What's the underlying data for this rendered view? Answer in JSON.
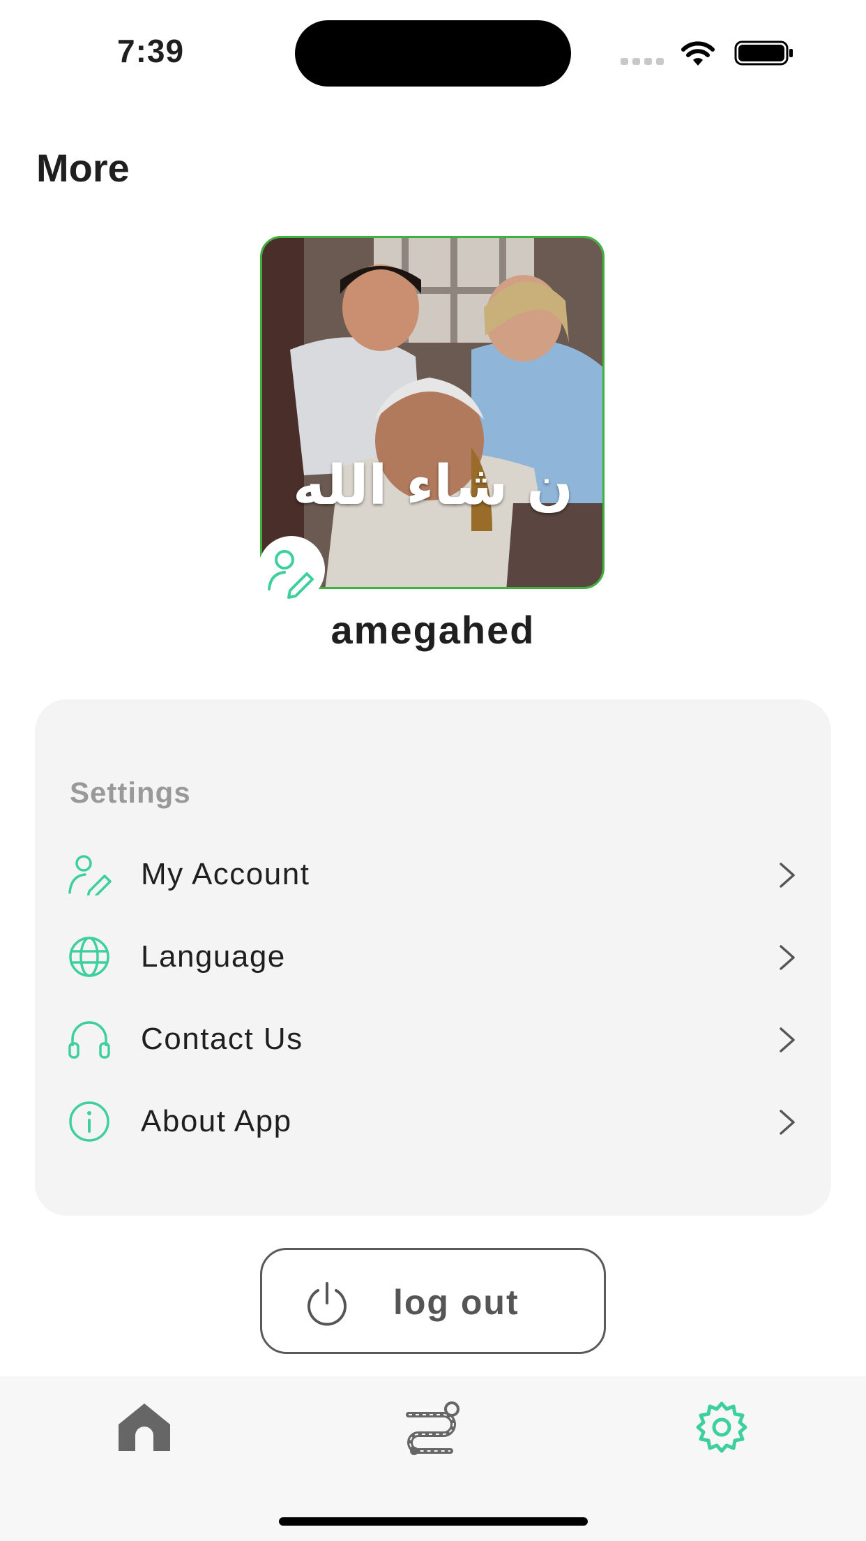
{
  "status_bar": {
    "time": "7:39"
  },
  "header": {
    "title": "More"
  },
  "profile": {
    "username": "amegahed",
    "avatar_caption": "ن شاء الله"
  },
  "settings": {
    "section_label": "Settings",
    "items": [
      {
        "label": "My Account",
        "icon": "user-edit-icon"
      },
      {
        "label": "Language",
        "icon": "globe-icon"
      },
      {
        "label": "Contact Us",
        "icon": "headset-icon"
      },
      {
        "label": "About App",
        "icon": "info-icon"
      }
    ]
  },
  "logout": {
    "label": "log out"
  },
  "tabbar": {
    "tabs": [
      {
        "icon": "home-icon",
        "active": false
      },
      {
        "icon": "route-icon",
        "active": false
      },
      {
        "icon": "gear-icon",
        "active": true
      }
    ]
  },
  "colors": {
    "accent": "#3ecf9e",
    "avatar_border": "#3db33d",
    "card_bg": "#f4f4f4",
    "muted": "#999999"
  }
}
